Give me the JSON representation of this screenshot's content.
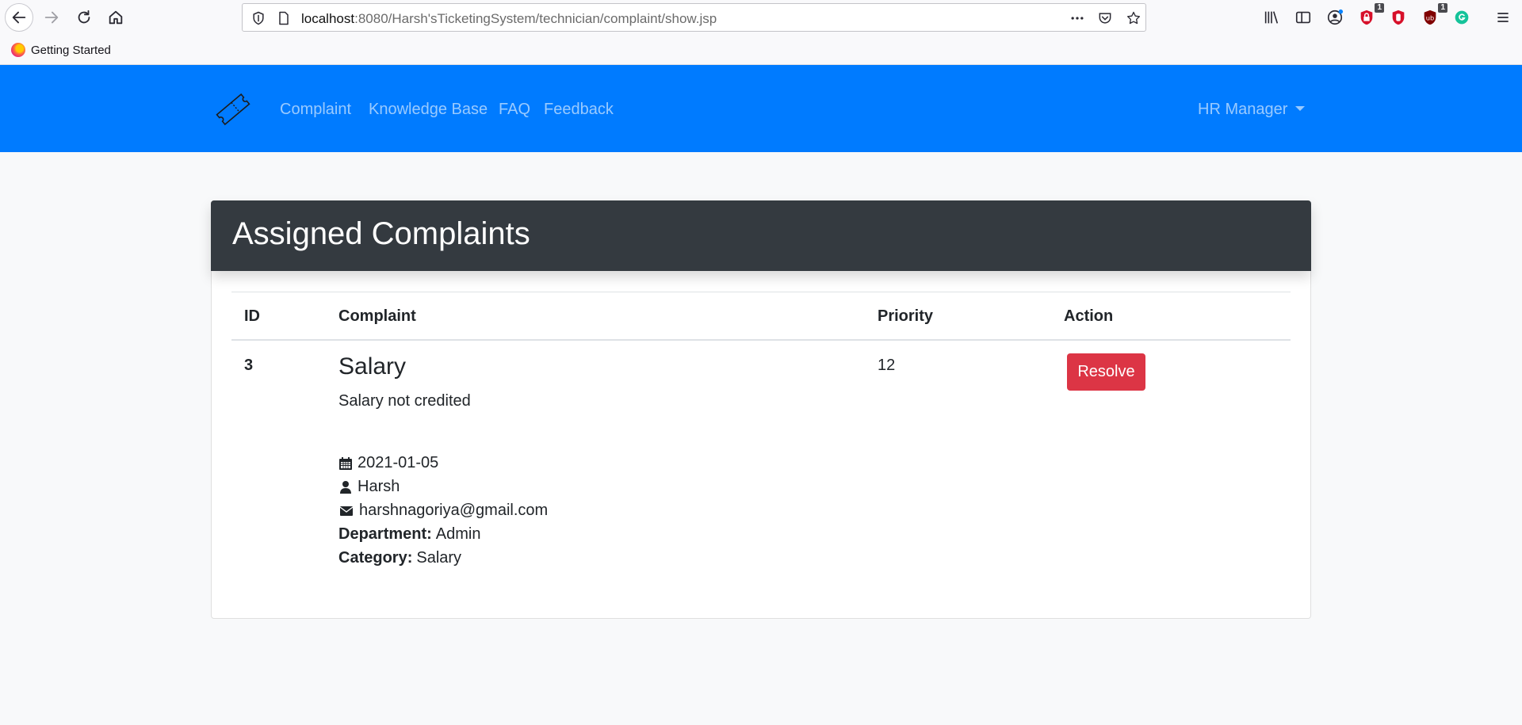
{
  "browser": {
    "url_host": "localhost",
    "url_path": ":8080/Harsh'sTicketingSystem/technician/complaint/show.jsp",
    "bookmark": "Getting Started",
    "badges": [
      "1",
      "1"
    ]
  },
  "navbar": {
    "links": [
      "Complaint",
      "Knowledge Base",
      "FAQ",
      "Feedback"
    ],
    "user_menu": "HR Manager",
    "color": "#007bff"
  },
  "card": {
    "title": "Assigned Complaints",
    "columns": [
      "ID",
      "Complaint",
      "Priority",
      "Action"
    ],
    "rows": [
      {
        "id": "3",
        "title": "Salary",
        "description": "Salary not credited",
        "date": "2021-01-05",
        "user": "Harsh",
        "email": "harshnagoriya@gmail.com",
        "department_label": "Department:",
        "department": "Admin",
        "category_label": "Category:",
        "category": "Salary",
        "priority": "12",
        "action": "Resolve"
      }
    ]
  }
}
